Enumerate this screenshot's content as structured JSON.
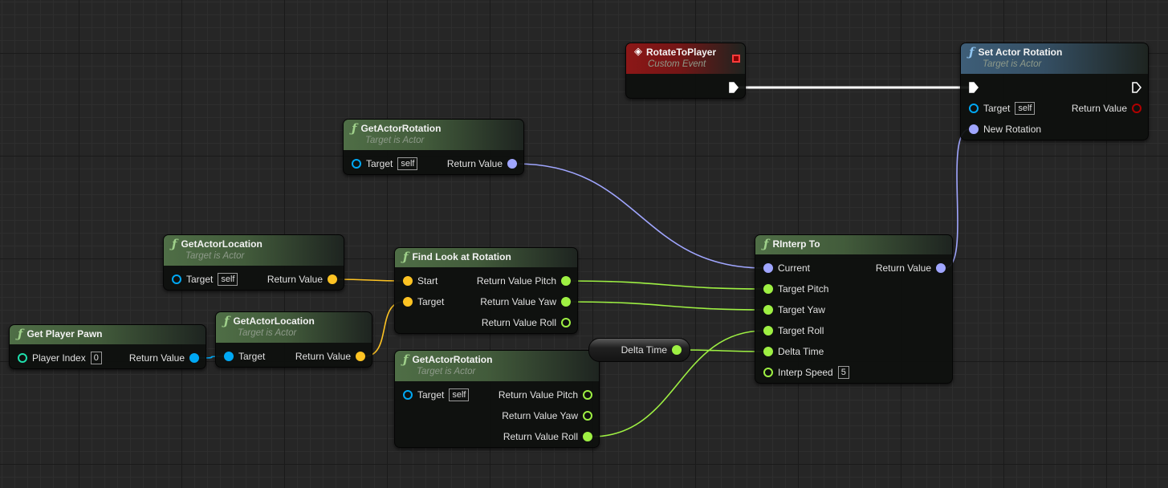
{
  "pin_colors": {
    "exec": "#ffffff",
    "object": "#00a8f4",
    "vector": "#fdc323",
    "rotator": "#a0a6ff",
    "float": "#9ef043",
    "int": "#1fe0ad",
    "object_return": "#b00000"
  },
  "header_colors": {
    "function": "#4f6e46",
    "target_function": "#3e5e78",
    "event": "#8c1717"
  },
  "nodes": [
    {
      "id": "rotate_to_player",
      "kind": "event",
      "title": "RotateToPlayer",
      "subtitle": "Custom Event",
      "icon": "event-diamond-icon",
      "rows": [
        {
          "out": {
            "id": "then",
            "type": "exec",
            "label": "",
            "connected": true
          }
        }
      ]
    },
    {
      "id": "set_actor_rotation",
      "kind": "target_function",
      "title": "Set Actor Rotation",
      "subtitle": "Target is Actor",
      "icon": "function-icon",
      "rows": [
        {
          "in": {
            "id": "exec",
            "type": "exec",
            "label": "",
            "connected": true
          },
          "out": {
            "id": "then",
            "type": "exec",
            "label": "",
            "connected": false
          }
        },
        {
          "in": {
            "id": "target",
            "type": "object",
            "label": "Target",
            "default": "self",
            "connected": false
          },
          "out": {
            "id": "ret",
            "type": "object_return",
            "label": "Return Value",
            "connected": false
          }
        },
        {
          "in": {
            "id": "new_rotation",
            "type": "rotator",
            "label": "New Rotation",
            "connected": true
          }
        }
      ]
    },
    {
      "id": "get_actor_rotation_1",
      "kind": "function",
      "title": "GetActorRotation",
      "subtitle": "Target is Actor",
      "icon": "function-icon",
      "rows": [
        {
          "in": {
            "id": "target",
            "type": "object",
            "label": "Target",
            "default": "self",
            "connected": false
          },
          "out": {
            "id": "ret",
            "type": "rotator",
            "label": "Return Value",
            "connected": true
          }
        }
      ]
    },
    {
      "id": "get_actor_location_1",
      "kind": "function",
      "title": "GetActorLocation",
      "subtitle": "Target is Actor",
      "icon": "function-icon",
      "rows": [
        {
          "in": {
            "id": "target",
            "type": "object",
            "label": "Target",
            "default": "self",
            "connected": false
          },
          "out": {
            "id": "ret",
            "type": "vector",
            "label": "Return Value",
            "connected": true
          }
        }
      ]
    },
    {
      "id": "find_look_at_rotation",
      "kind": "function",
      "title": "Find Look at Rotation",
      "icon": "function-icon",
      "rows": [
        {
          "in": {
            "id": "start",
            "type": "vector",
            "label": "Start",
            "connected": true
          },
          "out": {
            "id": "pitch",
            "type": "float",
            "label": "Return Value Pitch",
            "connected": true
          }
        },
        {
          "in": {
            "id": "target",
            "type": "vector",
            "label": "Target",
            "connected": true
          },
          "out": {
            "id": "yaw",
            "type": "float",
            "label": "Return Value Yaw",
            "connected": true
          }
        },
        {
          "out": {
            "id": "roll",
            "type": "float",
            "label": "Return Value Roll",
            "connected": false
          }
        }
      ]
    },
    {
      "id": "get_player_pawn",
      "kind": "function",
      "title": "Get Player Pawn",
      "icon": "function-icon",
      "rows": [
        {
          "in": {
            "id": "player_index",
            "type": "int",
            "label": "Player Index",
            "default": "0",
            "connected": false
          },
          "out": {
            "id": "ret",
            "type": "object",
            "label": "Return Value",
            "connected": true
          }
        }
      ]
    },
    {
      "id": "get_actor_location_2",
      "kind": "function",
      "title": "GetActorLocation",
      "subtitle": "Target is Actor",
      "icon": "function-icon",
      "rows": [
        {
          "in": {
            "id": "target",
            "type": "object",
            "label": "Target",
            "connected": true
          },
          "out": {
            "id": "ret",
            "type": "vector",
            "label": "Return Value",
            "connected": true
          }
        }
      ]
    },
    {
      "id": "get_actor_rotation_2",
      "kind": "function",
      "title": "GetActorRotation",
      "subtitle": "Target is Actor",
      "icon": "function-icon",
      "rows": [
        {
          "in": {
            "id": "target",
            "type": "object",
            "label": "Target",
            "default": "self",
            "connected": false
          },
          "out": {
            "id": "pitch",
            "type": "float",
            "label": "Return Value Pitch",
            "connected": false
          }
        },
        {
          "out": {
            "id": "yaw",
            "type": "float",
            "label": "Return Value Yaw",
            "connected": false
          }
        },
        {
          "out": {
            "id": "roll",
            "type": "float",
            "label": "Return Value Roll",
            "connected": true
          }
        }
      ]
    },
    {
      "id": "rinterp_to",
      "kind": "function",
      "title": "RInterp To",
      "icon": "function-icon",
      "rows": [
        {
          "in": {
            "id": "current",
            "type": "rotator",
            "label": "Current",
            "connected": true
          },
          "out": {
            "id": "ret",
            "type": "rotator",
            "label": "Return Value",
            "connected": true
          }
        },
        {
          "in": {
            "id": "target_pitch",
            "type": "float",
            "label": "Target Pitch",
            "connected": true
          }
        },
        {
          "in": {
            "id": "target_yaw",
            "type": "float",
            "label": "Target Yaw",
            "connected": true
          }
        },
        {
          "in": {
            "id": "target_roll",
            "type": "float",
            "label": "Target Roll",
            "connected": true
          }
        },
        {
          "in": {
            "id": "delta_time",
            "type": "float",
            "label": "Delta Time",
            "connected": true
          }
        },
        {
          "in": {
            "id": "interp_speed",
            "type": "float",
            "label": "Interp Speed",
            "default": "5",
            "connected": false
          }
        }
      ]
    }
  ],
  "variable_nodes": [
    {
      "id": "delta_time_var",
      "label": "Delta Time",
      "type": "float",
      "pin": "out"
    }
  ],
  "connections": [
    {
      "from": "rotate_to_player.then",
      "to": "set_actor_rotation.exec",
      "type": "exec"
    },
    {
      "from": "get_actor_rotation_1.ret",
      "to": "rinterp_to.current",
      "type": "rotator"
    },
    {
      "from": "rinterp_to.ret",
      "to": "set_actor_rotation.new_rotation",
      "type": "rotator"
    },
    {
      "from": "get_actor_location_1.ret",
      "to": "find_look_at_rotation.start",
      "type": "vector"
    },
    {
      "from": "get_actor_location_2.ret",
      "to": "find_look_at_rotation.target",
      "type": "vector"
    },
    {
      "from": "get_player_pawn.ret",
      "to": "get_actor_location_2.target",
      "type": "object"
    },
    {
      "from": "find_look_at_rotation.pitch",
      "to": "rinterp_to.target_pitch",
      "type": "float"
    },
    {
      "from": "find_look_at_rotation.yaw",
      "to": "rinterp_to.target_yaw",
      "type": "float"
    },
    {
      "from": "get_actor_rotation_2.roll",
      "to": "rinterp_to.target_roll",
      "type": "float"
    },
    {
      "from": "delta_time_var.out",
      "to": "rinterp_to.delta_time",
      "type": "float"
    }
  ]
}
